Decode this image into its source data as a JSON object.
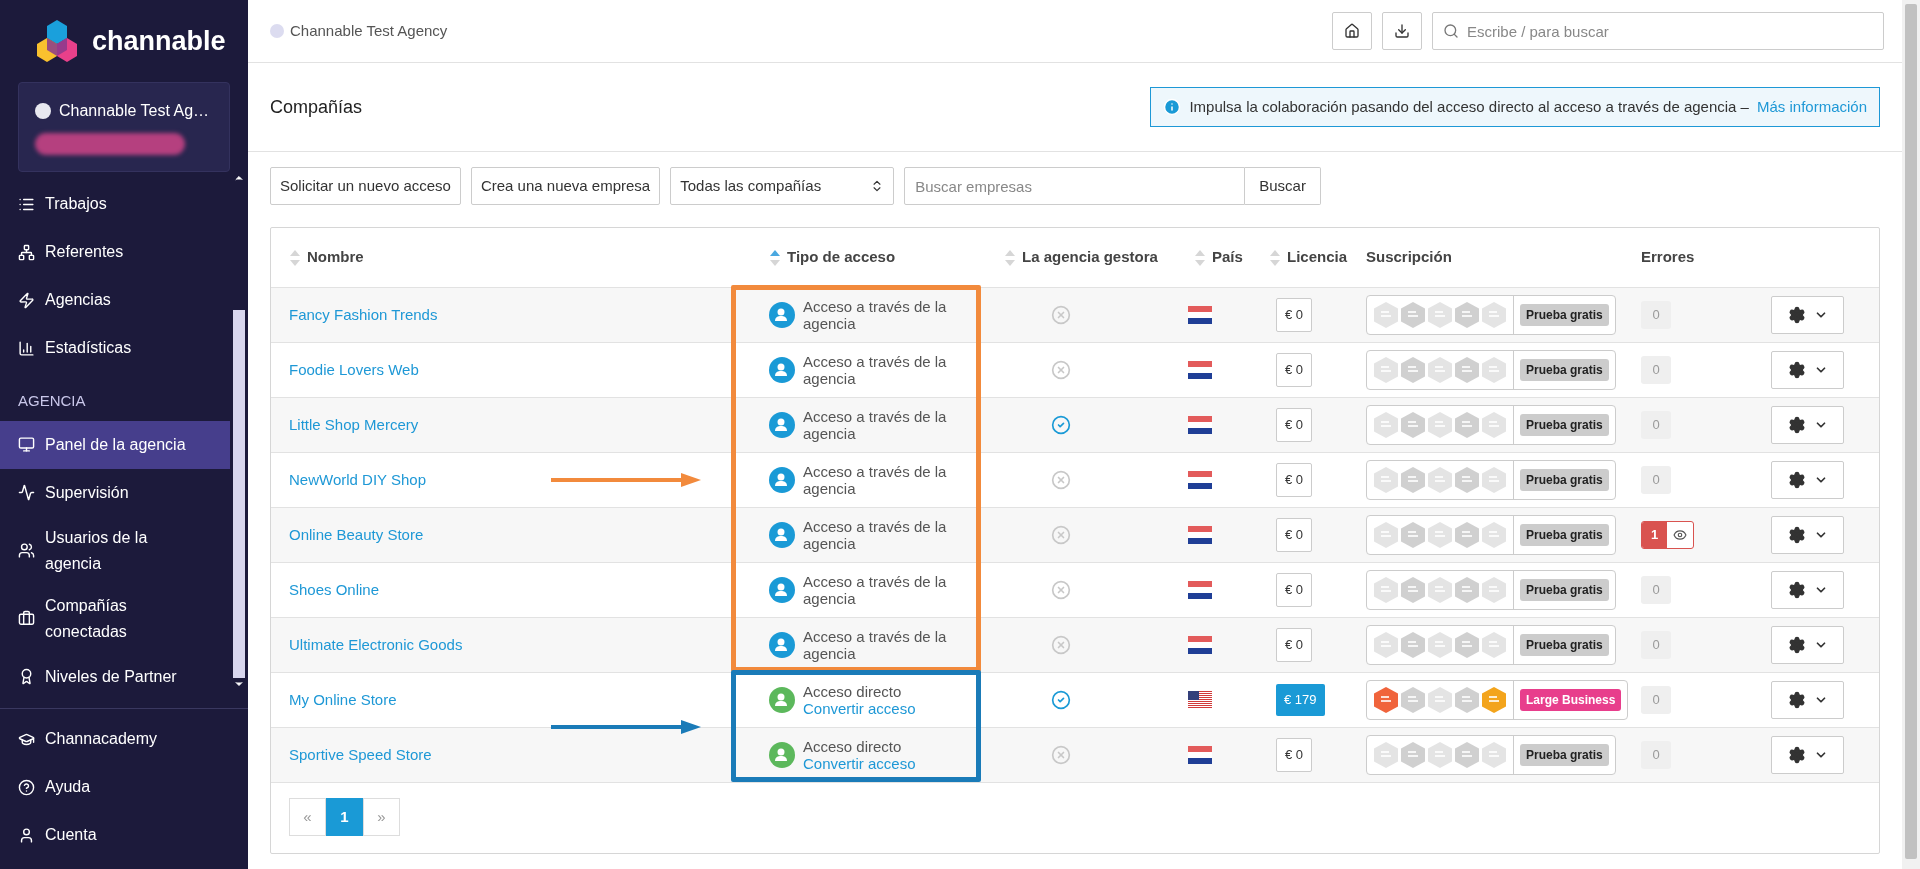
{
  "sidebar": {
    "logo": "channable",
    "account": {
      "name": "Channable Test Ag…"
    },
    "items": [
      {
        "label": "Trabajos",
        "selected": false
      },
      {
        "label": "Referentes",
        "selected": false
      },
      {
        "label": "Agencias",
        "selected": false
      },
      {
        "label": "Estadísticas",
        "selected": false
      },
      {
        "kind": "section",
        "label": "AGENCIA"
      },
      {
        "label": "Panel de la agencia",
        "selected": true
      },
      {
        "label": "Supervisión",
        "selected": false
      },
      {
        "label": "Usuarios de la agencia",
        "selected": false
      },
      {
        "label": "Compañías conectadas",
        "selected": false
      },
      {
        "label": "Niveles de Partner",
        "selected": false
      }
    ],
    "bottom_items": [
      {
        "label": "Channacademy"
      },
      {
        "label": "Ayuda"
      },
      {
        "label": "Cuenta"
      }
    ]
  },
  "topbar": {
    "breadcrumb": "Channable Test Agency",
    "search": {
      "placeholder": "Escribe / para buscar"
    }
  },
  "page": {
    "title": "Compañías",
    "banner": {
      "text": "Impulsa la colaboración pasando del acceso directo al acceso a través de agencia –",
      "link": "Más información"
    }
  },
  "toolbar": {
    "buttons": [
      "Solicitar un nuevo acceso",
      "Crea una nueva empresa"
    ],
    "filter": "Todas las compañías",
    "search": {
      "placeholder": "Buscar empresas"
    },
    "search_button": "Buscar"
  },
  "table": {
    "columns": [
      {
        "label": "Nombre",
        "sortable": true,
        "sorted": false
      },
      {
        "label": "Tipo de acceso",
        "sortable": true,
        "sorted": true
      },
      {
        "label": "La agencia gestora",
        "sortable": true,
        "sorted": false
      },
      {
        "label": "País",
        "sortable": true,
        "sorted": false
      },
      {
        "label": "Licencia",
        "sortable": true,
        "sorted": false
      },
      {
        "label": "Suscripción",
        "sortable": false
      },
      {
        "label": "Errores",
        "sortable": false
      }
    ],
    "groups": [
      {
        "color": "#f28a3c",
        "rows": [
          {
            "name": "Fancy Fashion Trends",
            "access": {
              "kind": "agency",
              "label": "Acceso a través de la agencia"
            },
            "managed": false,
            "flag": {
              "kind": "nl"
            },
            "license": {
              "text": "€ 0",
              "paid": false
            },
            "modules": [
              false,
              false,
              false,
              false,
              false
            ],
            "plan": {
              "label": "Prueba gratis",
              "color": "#cccccc"
            },
            "errors": {
              "count": "0",
              "has_errors": false
            }
          },
          {
            "name": "Foodie Lovers Web",
            "access": {
              "kind": "agency",
              "label": "Acceso a través de la agencia"
            },
            "managed": false,
            "flag": {
              "kind": "nl"
            },
            "license": {
              "text": "€ 0",
              "paid": false
            },
            "modules": [
              false,
              false,
              false,
              false,
              false
            ],
            "plan": {
              "label": "Prueba gratis",
              "color": "#cccccc"
            },
            "errors": {
              "count": "0",
              "has_errors": false
            }
          },
          {
            "name": "Little Shop Mercery",
            "access": {
              "kind": "agency",
              "label": "Acceso a través de la agencia"
            },
            "managed": true,
            "flag": {
              "kind": "nl"
            },
            "license": {
              "text": "€ 0",
              "paid": false
            },
            "modules": [
              false,
              false,
              false,
              false,
              false
            ],
            "plan": {
              "label": "Prueba gratis",
              "color": "#cccccc"
            },
            "errors": {
              "count": "0",
              "has_errors": false
            }
          },
          {
            "name": "NewWorld DIY Shop",
            "access": {
              "kind": "agency",
              "label": "Acceso a través de la agencia"
            },
            "managed": false,
            "flag": {
              "kind": "nl"
            },
            "license": {
              "text": "€ 0",
              "paid": false
            },
            "modules": [
              false,
              false,
              false,
              false,
              false
            ],
            "plan": {
              "label": "Prueba gratis",
              "color": "#cccccc"
            },
            "errors": {
              "count": "0",
              "has_errors": false
            }
          },
          {
            "name": "Online Beauty Store",
            "access": {
              "kind": "agency",
              "label": "Acceso a través de la agencia"
            },
            "managed": false,
            "flag": {
              "kind": "nl"
            },
            "license": {
              "text": "€ 0",
              "paid": false
            },
            "modules": [
              false,
              false,
              false,
              false,
              false
            ],
            "plan": {
              "label": "Prueba gratis",
              "color": "#cccccc"
            },
            "errors": {
              "count": "1",
              "has_errors": true
            }
          },
          {
            "name": "Shoes Online",
            "access": {
              "kind": "agency",
              "label": "Acceso a través de la agencia"
            },
            "managed": false,
            "flag": {
              "kind": "nl"
            },
            "license": {
              "text": "€ 0",
              "paid": false
            },
            "modules": [
              false,
              false,
              false,
              false,
              false
            ],
            "plan": {
              "label": "Prueba gratis",
              "color": "#cccccc"
            },
            "errors": {
              "count": "0",
              "has_errors": false
            }
          },
          {
            "name": "Ultimate Electronic Goods",
            "access": {
              "kind": "agency",
              "label": "Acceso a través de la agencia"
            },
            "managed": false,
            "flag": {
              "kind": "nl"
            },
            "license": {
              "text": "€ 0",
              "paid": false
            },
            "modules": [
              false,
              false,
              false,
              false,
              false
            ],
            "plan": {
              "label": "Prueba gratis",
              "color": "#cccccc"
            },
            "errors": {
              "count": "0",
              "has_errors": false
            }
          }
        ]
      },
      {
        "color": "#1a7bb8",
        "rows": [
          {
            "name": "My Online Store",
            "access": {
              "kind": "direct",
              "label": "Acceso directo",
              "link": "Convertir acceso"
            },
            "managed": true,
            "flag": {
              "kind": "us"
            },
            "license": {
              "text": "€ 179",
              "paid": true
            },
            "modules": [
              true,
              false,
              false,
              false,
              true
            ],
            "plan": {
              "label": "Large Business",
              "color": "#e83e8c"
            },
            "errors": {
              "count": "0",
              "has_errors": false
            }
          },
          {
            "name": "Sportive Speed Store",
            "access": {
              "kind": "direct",
              "label": "Acceso directo",
              "link": "Convertir acceso"
            },
            "managed": false,
            "flag": {
              "kind": "nl"
            },
            "license": {
              "text": "€ 0",
              "paid": false
            },
            "modules": [
              false,
              false,
              false,
              false,
              false
            ],
            "plan": {
              "label": "Prueba gratis",
              "color": "#cccccc"
            },
            "errors": {
              "count": "0",
              "has_errors": false
            }
          }
        ]
      }
    ]
  },
  "pagination": [
    {
      "label": "«",
      "selected": false
    },
    {
      "label": "1",
      "selected": true
    },
    {
      "label": "»",
      "selected": false
    }
  ]
}
